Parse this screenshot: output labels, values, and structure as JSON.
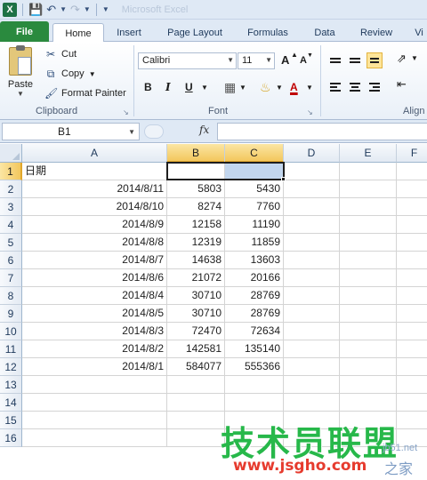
{
  "quick_access": {
    "app_icon": "X",
    "title": "Microsoft Excel"
  },
  "tabs": [
    {
      "label": "File"
    },
    {
      "label": "Home"
    },
    {
      "label": "Insert"
    },
    {
      "label": "Page Layout"
    },
    {
      "label": "Formulas"
    },
    {
      "label": "Data"
    },
    {
      "label": "Review"
    },
    {
      "label": "Vi"
    }
  ],
  "ribbon": {
    "clipboard": {
      "paste_label": "Paste",
      "cut_label": "Cut",
      "copy_label": "Copy",
      "format_painter_label": "Format Painter",
      "group_label": "Clipboard"
    },
    "font": {
      "font_name": "Calibri",
      "font_size": "11",
      "bold": "B",
      "italic": "I",
      "underline": "U",
      "grow": "A",
      "shrink": "A",
      "font_color_letter": "A",
      "group_label": "Font"
    },
    "alignment": {
      "group_label": "Align"
    }
  },
  "formula_bar": {
    "name_box": "B1",
    "fx": "fx",
    "formula": ""
  },
  "sheet": {
    "columns": [
      "A",
      "B",
      "C",
      "D",
      "E",
      "F"
    ],
    "selected_columns": [
      "B",
      "C"
    ],
    "selected_row": "1",
    "rows": [
      {
        "n": "1",
        "a": "日期",
        "b": "",
        "c": ""
      },
      {
        "n": "2",
        "a": "2014/8/11",
        "b": "5803",
        "c": "5430"
      },
      {
        "n": "3",
        "a": "2014/8/10",
        "b": "8274",
        "c": "7760"
      },
      {
        "n": "4",
        "a": "2014/8/9",
        "b": "12158",
        "c": "11190"
      },
      {
        "n": "5",
        "a": "2014/8/8",
        "b": "12319",
        "c": "11859"
      },
      {
        "n": "6",
        "a": "2014/8/7",
        "b": "14638",
        "c": "13603"
      },
      {
        "n": "7",
        "a": "2014/8/6",
        "b": "21072",
        "c": "20166"
      },
      {
        "n": "8",
        "a": "2014/8/4",
        "b": "30710",
        "c": "28769"
      },
      {
        "n": "9",
        "a": "2014/8/5",
        "b": "30710",
        "c": "28769"
      },
      {
        "n": "10",
        "a": "2014/8/3",
        "b": "72470",
        "c": "72634"
      },
      {
        "n": "11",
        "a": "2014/8/2",
        "b": "142581",
        "c": "135140"
      },
      {
        "n": "12",
        "a": "2014/8/1",
        "b": "584077",
        "c": "555366"
      },
      {
        "n": "13",
        "a": "",
        "b": "",
        "c": ""
      },
      {
        "n": "14",
        "a": "",
        "b": "",
        "c": ""
      },
      {
        "n": "15",
        "a": "",
        "b": "",
        "c": ""
      },
      {
        "n": "16",
        "a": "",
        "b": "",
        "c": ""
      }
    ]
  },
  "watermark": {
    "brand": "技术员联盟",
    "site": "www.jsgho.com",
    "small": "jb51.net",
    "home": "之家"
  }
}
